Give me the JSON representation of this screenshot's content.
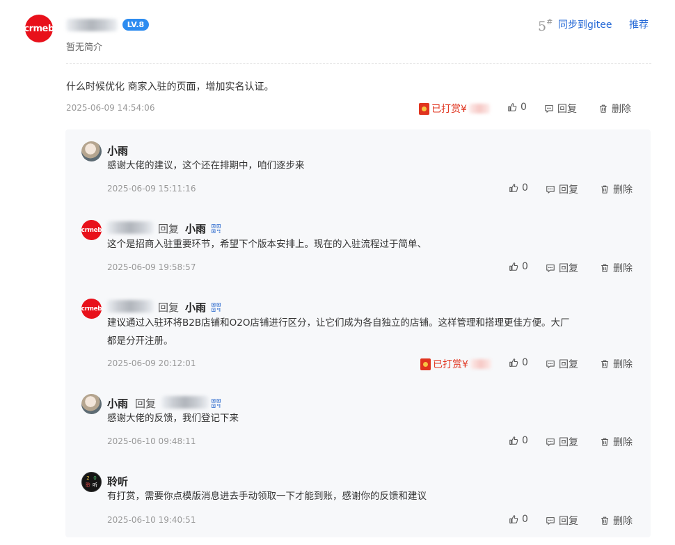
{
  "post": {
    "avatar_text": "crmeb",
    "level": "LV.8",
    "intro": "暂无简介",
    "floor": "5",
    "floor_mark": "#",
    "sync_label": "同步到gitee",
    "recommend_label": "推荐",
    "content": "什么时候优化 商家入驻的页面，增加实名认证。",
    "date": "2025-06-09 14:54:06",
    "reward_label": "已打赏¥",
    "likes": "0",
    "reply_label": "回复",
    "delete_label": "删除"
  },
  "replies": [
    {
      "name": "小雨",
      "text": "感谢大佬的建议，这个还在排期中，咱们逐步来",
      "date": "2025-06-09 15:11:16",
      "likes": "0"
    },
    {
      "reply_word": "回复",
      "target": "小雨",
      "avatar_text": "crmeb",
      "text": "这个是招商入驻重要环节，希望下个版本安排上。现在的入驻流程过于简单、",
      "date": "2025-06-09 19:58:57",
      "likes": "0"
    },
    {
      "reply_word": "回复",
      "target": "小雨",
      "avatar_text": "crmeb",
      "text_line1": "建议通过入驻环将B2B店铺和O2O店铺进行区分，让它们成为各自独立的店铺。这样管理和搭理更佳方便。大厂",
      "text_line2": "都是分开注册。",
      "date": "2025-06-09 20:12:01",
      "reward_label": "已打赏¥",
      "likes": "0"
    },
    {
      "name": "小雨",
      "reply_word": "回复",
      "text": "感谢大佬的反馈，我们登记下来",
      "date": "2025-06-10 09:48:11",
      "likes": "0"
    },
    {
      "name": "聆听",
      "avatar_chars": [
        "2",
        "0",
        "聆",
        "听"
      ],
      "text": "有打赏，需要你点模版消息进去手动领取一下才能到账，感谢你的反馈和建议",
      "date": "2025-06-10 19:40:51",
      "likes": "0"
    }
  ],
  "actions": {
    "reply_label": "回复",
    "delete_label": "删除"
  },
  "colors": {
    "brand_red": "#e8111b",
    "link_blue": "#2468d6",
    "badge_blue": "#2d8cf0",
    "reward_red": "#e0341f"
  },
  "icons": [
    "crmeb-logo-icon",
    "red-packet-icon",
    "thumb-up-icon",
    "comment-icon",
    "trash-icon",
    "qr-code-icon"
  ]
}
